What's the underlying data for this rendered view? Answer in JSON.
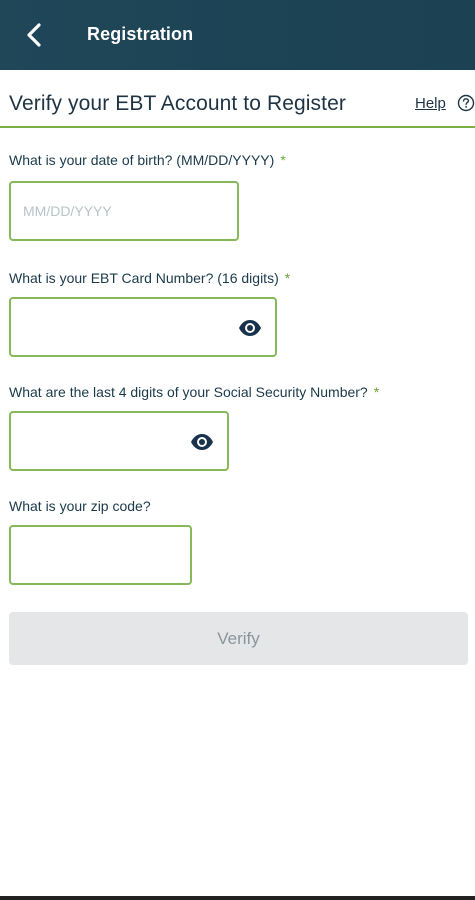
{
  "header": {
    "title": "Registration",
    "back_icon": "chevron-left-icon",
    "background_color": "#1f4758"
  },
  "page": {
    "title": "Verify your EBT Account to Register",
    "help_label": "Help",
    "help_icon": "question-circle-icon"
  },
  "form": {
    "dob": {
      "label": "What is your date of birth? (MM/DD/YYYY)",
      "required_marker": "*",
      "placeholder": "MM/DD/YYYY",
      "value": ""
    },
    "card_number": {
      "label": "What is your EBT Card Number? (16 digits)",
      "required_marker": "*",
      "value": "",
      "toggle_icon": "eye-icon"
    },
    "ssn": {
      "label": "What are the last 4 digits of your Social Security Number?",
      "required_marker": "*",
      "value": "",
      "toggle_icon": "eye-icon"
    },
    "zip": {
      "label": "What is your zip code?",
      "value": ""
    },
    "submit_label": "Verify"
  },
  "colors": {
    "accent_green": "#7bb047",
    "text_dark": "#1e3444",
    "button_disabled_bg": "#e4e6e8",
    "button_disabled_text": "#8a969c"
  }
}
